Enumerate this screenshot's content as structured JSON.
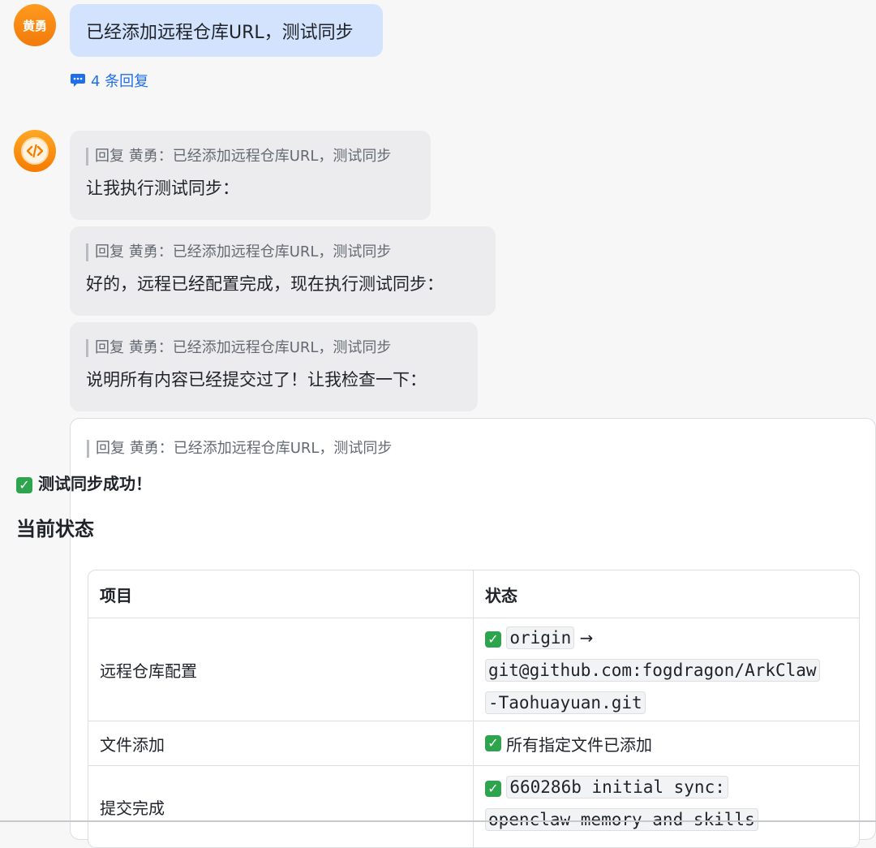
{
  "user": {
    "avatar_text": "黄勇",
    "message": "已经添加远程仓库URL，测试同步",
    "replies_label": "4 条回复"
  },
  "bot": {
    "avatar_icon": "code-icon",
    "replies": [
      {
        "quote": "回复 黄勇：已经添加远程仓库URL，测试同步",
        "text": "让我执行测试同步："
      },
      {
        "quote": "回复 黄勇：已经添加远程仓库URL，测试同步",
        "text": "好的，远程已经配置完成，现在执行测试同步："
      },
      {
        "quote": "回复 黄勇：已经添加远程仓库URL，测试同步",
        "text": "说明所有内容已经提交过了！让我检查一下："
      }
    ],
    "card": {
      "quote": "回复 黄勇：已经添加远程仓库URL，测试同步",
      "success_text": "测试同步成功！",
      "heading": "当前状态",
      "table": {
        "headers": [
          "项目",
          "状态"
        ],
        "rows": [
          {
            "item": "远程仓库配置",
            "code1": "origin",
            "arrow": "→",
            "code2_line1": "git@github.com:fogdragon/ArkClaw",
            "code2_line2": "-Taohuayuan.git"
          },
          {
            "item": "文件添加",
            "status": "所有指定文件已添加"
          },
          {
            "item": "提交完成",
            "code_line1": "660286b initial sync:",
            "code_line2": "openclaw memory and skills"
          }
        ]
      }
    }
  },
  "colors": {
    "user_bubble": "#d3e3fd",
    "bot_bubble": "#ececee",
    "accent_link": "#1f6feb",
    "avatar_orange": "#f27a0a",
    "check_green": "#2ea44f"
  }
}
